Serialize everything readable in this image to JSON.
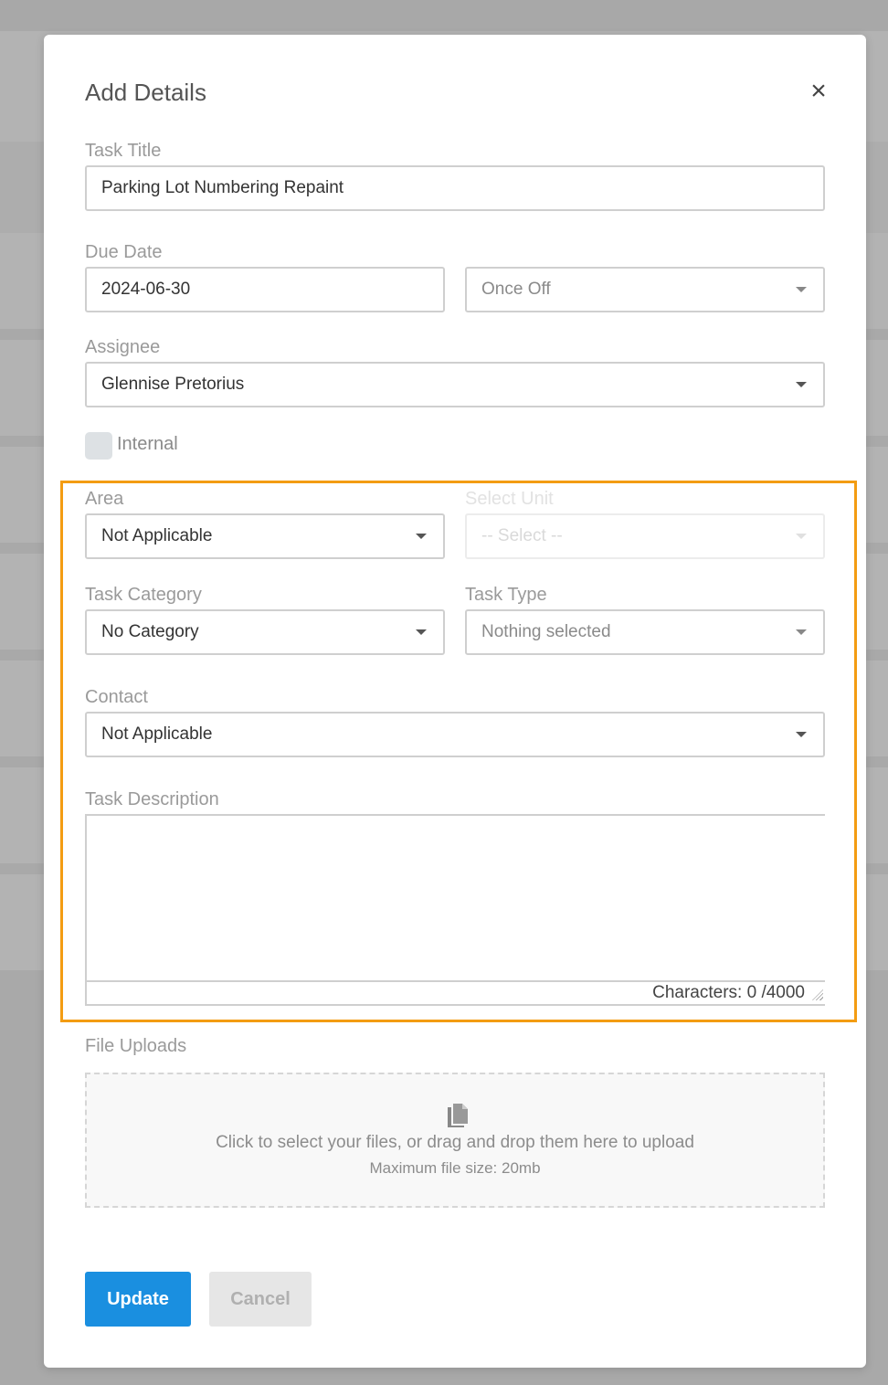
{
  "modal": {
    "title": "Add Details",
    "close_symbol": "×"
  },
  "form": {
    "task_title": {
      "label": "Task Title",
      "value": "Parking Lot Numbering Repaint"
    },
    "due_date": {
      "label": "Due Date",
      "value": "2024-06-30"
    },
    "recurrence": {
      "value": "Once Off"
    },
    "assignee": {
      "label": "Assignee",
      "value": "Glennise Pretorius"
    },
    "internal": {
      "label": "Internal",
      "checked": false
    },
    "area": {
      "label": "Area",
      "value": "Not Applicable"
    },
    "select_unit": {
      "label": "Select Unit",
      "value": "-- Select --",
      "disabled": true
    },
    "task_category": {
      "label": "Task Category",
      "value": "No Category"
    },
    "task_type": {
      "label": "Task Type",
      "value": "Nothing selected"
    },
    "contact": {
      "label": "Contact",
      "value": "Not Applicable"
    },
    "task_description": {
      "label": "Task Description",
      "value": "",
      "counter": "Characters: 0 /4000"
    }
  },
  "uploads": {
    "label": "File Uploads",
    "icon": "file-copy-icon",
    "instruction": "Click to select your files, or drag and drop them here to upload",
    "max_size": "Maximum file size: 20mb"
  },
  "actions": {
    "update_label": "Update",
    "cancel_label": "Cancel"
  },
  "colors": {
    "primary": "#1a8fe0",
    "highlight": "#f39c12",
    "overlay": "#b3b3b3"
  }
}
